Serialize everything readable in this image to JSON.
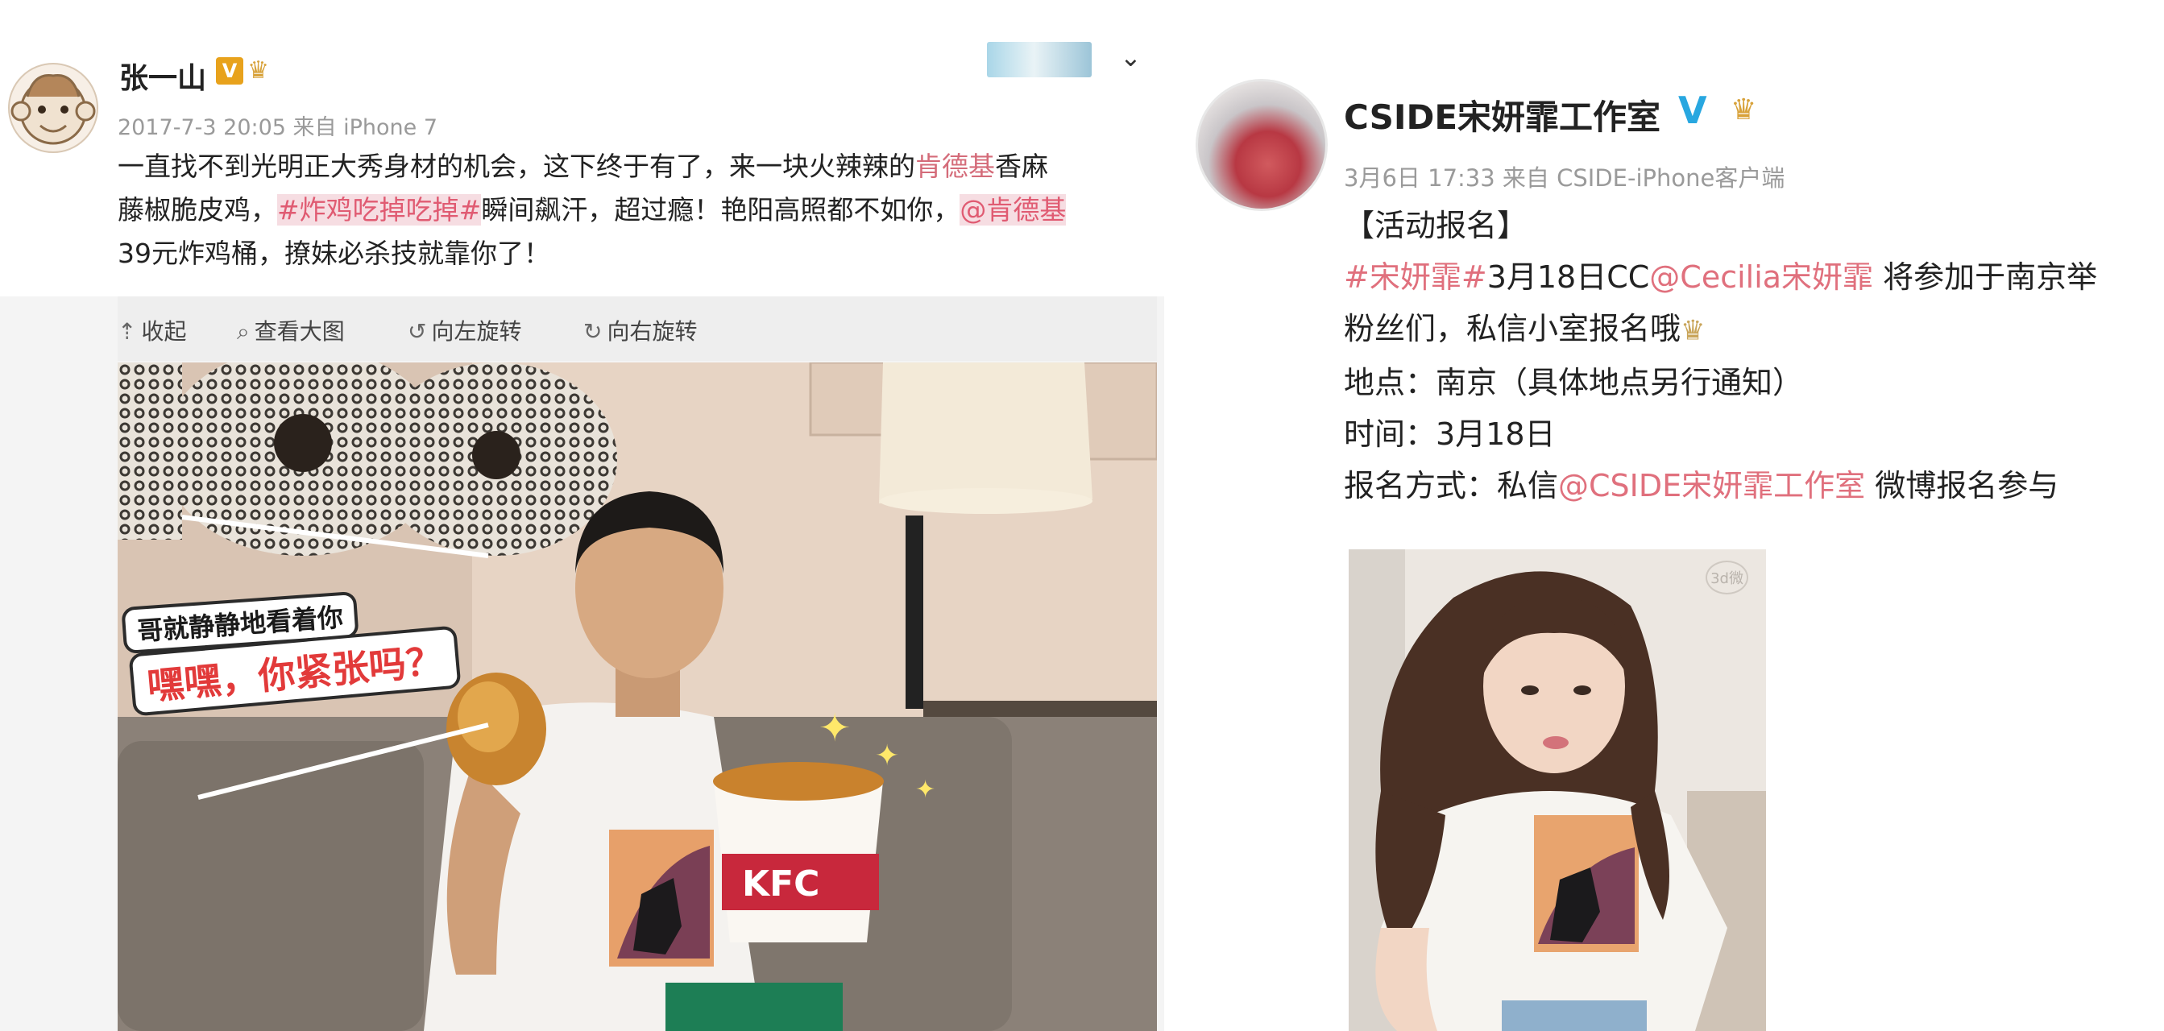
{
  "left_post": {
    "author": "张一山",
    "verified_badge": "V",
    "timestamp": "2017-7-3 20:05 来自 iPhone 7",
    "text_lines": [
      {
        "plain": "一直找不到光明正大秀身材的机会，这下终于有了，来一块火辣辣的",
        "tag": "肯德基",
        "tail": "香麻"
      },
      {
        "plain": "藤椒脆皮鸡，",
        "tag": "#炸鸡吃掉吃掉#",
        "tail": "瞬间飙汗，超过瘾！艳阳高照都不如你，",
        "mention": "@肯德基"
      },
      {
        "plain": "39元炸鸡桶，撩妹必杀技就靠你了！"
      }
    ],
    "toolbar": {
      "collect": "收起",
      "view_large": "查看大图",
      "rotate_left": "向左旋转",
      "rotate_right": "向右旋转"
    },
    "photo": {
      "caption_top": "哥就静静地看着你",
      "caption_bottom": "嘿嘿，你紧张吗？",
      "bucket_brand": "KFC"
    }
  },
  "right_post": {
    "author": "CSIDE宋妍霏工作室",
    "timestamp": "3月6日 17:33 来自 CSIDE-iPhone客户端",
    "line1": "【活动报名】",
    "line2_tag": "#宋妍霏#",
    "line2_mid": "3月18日CC",
    "line2_mention": "@Cecilia宋妍霏",
    "line2_tail": " 将参加于南京举",
    "line3": "粉丝们，私信小室报名哦",
    "line4": "地点：南京（具体地点另行通知）",
    "line5": "时间：3月18日",
    "line6_pre": "报名方式：私信",
    "line6_mention": "@CSIDE宋妍霏工作室",
    "line6_tail": " 微博报名参与",
    "photo_watermark": "3d微"
  },
  "colors": {
    "link": "#e0707d",
    "verified_blue": "#28a7e0",
    "verified_gold": "#e8a21c",
    "kfc_red": "#c8283c"
  }
}
